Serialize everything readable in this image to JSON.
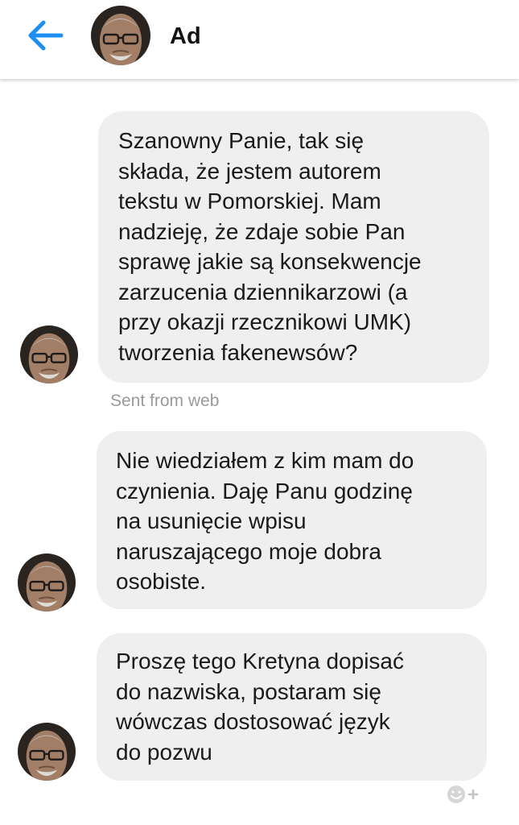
{
  "header": {
    "name": "Ad",
    "back_icon": "arrow-left-icon",
    "accent_color": "#1d8ef2"
  },
  "messages": [
    {
      "text": "Szanowny Panie, tak się\nskłada, że jestem autorem\ntekstu w Pomorskiej. Mam\nnadzieję, że zdaje sobie Pan\nsprawę jakie są konsekwencje\nzarzucenia dziennikarzowi (a\nprzy okazji rzecznikowi UMK)\ntworzenia fakenewsów?",
      "meta": "Sent from web"
    },
    {
      "text": "Nie wiedziałem z kim mam do\nczynienia. Daję Panu godzinę\nna usunięcie wpisu\nnaruszającego moje dobra\nosobiste."
    },
    {
      "text": "Proszę tego Kretyna dopisać\ndo nazwiska, postaram się\nwówczas dostosować język\ndo pozwu"
    }
  ],
  "bubble_color": "#efefef",
  "reaction_icon": "add-reaction-icon"
}
